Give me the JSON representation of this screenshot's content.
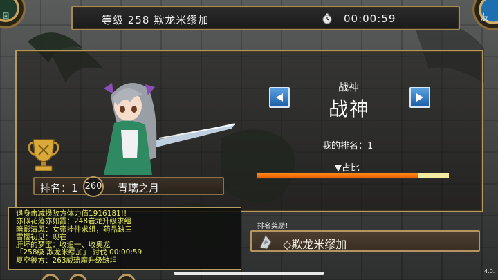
{
  "header": {
    "level_label": "等级",
    "level_value": "258",
    "boss_name": "欺龙米缪加",
    "timer": "00:00:59"
  },
  "corner_buttons": {
    "left_text": "回",
    "right_text": "友"
  },
  "panel": {
    "title_small": "战神",
    "title_big": "战神",
    "my_rank_label": "我的排名：",
    "my_rank_value": "1",
    "share_label": "▼占比",
    "share_fraction": 0.84,
    "rank_label": "排名：1",
    "player_level": "260",
    "player_name": "青璃之月"
  },
  "chat": {
    "lines": [
      "退身击减损敌方体力值1916181!!",
      "亦似花落亦如霞：248岩龙升级求组",
      "暗影清风：女帝挂件求组，药品缺三",
      "雪樱初见：现在",
      "肝坏的梦宝：收追一、收奥龙",
      "「258级 欺龙米缪加」 讨伐 00:00:59",
      "夏空彼方：263威琉魔升级缺坦"
    ]
  },
  "reward": {
    "label": "排名奖励！",
    "name": "◇欺龙米缪加"
  },
  "version": "4.0.",
  "colors": {
    "gold_border": "#b5995e",
    "share_fill": "#e85d00",
    "share_track": "#f3eca0",
    "chat_text": "#e9ee5e",
    "arrow_blue": "#1d5ea8"
  },
  "icons": [
    "stopwatch-icon",
    "trophy-icon",
    "arrow-left-icon",
    "arrow-right-icon",
    "reward-item-icon"
  ]
}
